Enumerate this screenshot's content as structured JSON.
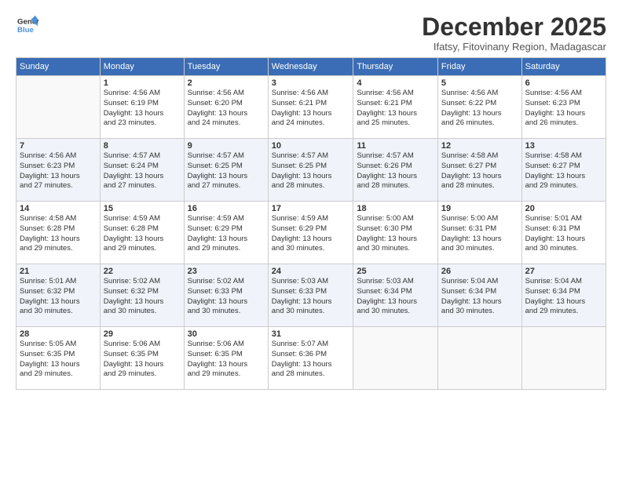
{
  "logo": {
    "general": "General",
    "blue": "Blue"
  },
  "title": "December 2025",
  "location": "Ifatsy, Fitovinany Region, Madagascar",
  "headers": [
    "Sunday",
    "Monday",
    "Tuesday",
    "Wednesday",
    "Thursday",
    "Friday",
    "Saturday"
  ],
  "weeks": [
    [
      {
        "day": "",
        "info": ""
      },
      {
        "day": "1",
        "info": "Sunrise: 4:56 AM\nSunset: 6:19 PM\nDaylight: 13 hours\nand 23 minutes."
      },
      {
        "day": "2",
        "info": "Sunrise: 4:56 AM\nSunset: 6:20 PM\nDaylight: 13 hours\nand 24 minutes."
      },
      {
        "day": "3",
        "info": "Sunrise: 4:56 AM\nSunset: 6:21 PM\nDaylight: 13 hours\nand 24 minutes."
      },
      {
        "day": "4",
        "info": "Sunrise: 4:56 AM\nSunset: 6:21 PM\nDaylight: 13 hours\nand 25 minutes."
      },
      {
        "day": "5",
        "info": "Sunrise: 4:56 AM\nSunset: 6:22 PM\nDaylight: 13 hours\nand 26 minutes."
      },
      {
        "day": "6",
        "info": "Sunrise: 4:56 AM\nSunset: 6:23 PM\nDaylight: 13 hours\nand 26 minutes."
      }
    ],
    [
      {
        "day": "7",
        "info": "Sunrise: 4:56 AM\nSunset: 6:23 PM\nDaylight: 13 hours\nand 27 minutes."
      },
      {
        "day": "8",
        "info": "Sunrise: 4:57 AM\nSunset: 6:24 PM\nDaylight: 13 hours\nand 27 minutes."
      },
      {
        "day": "9",
        "info": "Sunrise: 4:57 AM\nSunset: 6:25 PM\nDaylight: 13 hours\nand 27 minutes."
      },
      {
        "day": "10",
        "info": "Sunrise: 4:57 AM\nSunset: 6:25 PM\nDaylight: 13 hours\nand 28 minutes."
      },
      {
        "day": "11",
        "info": "Sunrise: 4:57 AM\nSunset: 6:26 PM\nDaylight: 13 hours\nand 28 minutes."
      },
      {
        "day": "12",
        "info": "Sunrise: 4:58 AM\nSunset: 6:27 PM\nDaylight: 13 hours\nand 28 minutes."
      },
      {
        "day": "13",
        "info": "Sunrise: 4:58 AM\nSunset: 6:27 PM\nDaylight: 13 hours\nand 29 minutes."
      }
    ],
    [
      {
        "day": "14",
        "info": "Sunrise: 4:58 AM\nSunset: 6:28 PM\nDaylight: 13 hours\nand 29 minutes."
      },
      {
        "day": "15",
        "info": "Sunrise: 4:59 AM\nSunset: 6:28 PM\nDaylight: 13 hours\nand 29 minutes."
      },
      {
        "day": "16",
        "info": "Sunrise: 4:59 AM\nSunset: 6:29 PM\nDaylight: 13 hours\nand 29 minutes."
      },
      {
        "day": "17",
        "info": "Sunrise: 4:59 AM\nSunset: 6:29 PM\nDaylight: 13 hours\nand 30 minutes."
      },
      {
        "day": "18",
        "info": "Sunrise: 5:00 AM\nSunset: 6:30 PM\nDaylight: 13 hours\nand 30 minutes."
      },
      {
        "day": "19",
        "info": "Sunrise: 5:00 AM\nSunset: 6:31 PM\nDaylight: 13 hours\nand 30 minutes."
      },
      {
        "day": "20",
        "info": "Sunrise: 5:01 AM\nSunset: 6:31 PM\nDaylight: 13 hours\nand 30 minutes."
      }
    ],
    [
      {
        "day": "21",
        "info": "Sunrise: 5:01 AM\nSunset: 6:32 PM\nDaylight: 13 hours\nand 30 minutes."
      },
      {
        "day": "22",
        "info": "Sunrise: 5:02 AM\nSunset: 6:32 PM\nDaylight: 13 hours\nand 30 minutes."
      },
      {
        "day": "23",
        "info": "Sunrise: 5:02 AM\nSunset: 6:33 PM\nDaylight: 13 hours\nand 30 minutes."
      },
      {
        "day": "24",
        "info": "Sunrise: 5:03 AM\nSunset: 6:33 PM\nDaylight: 13 hours\nand 30 minutes."
      },
      {
        "day": "25",
        "info": "Sunrise: 5:03 AM\nSunset: 6:34 PM\nDaylight: 13 hours\nand 30 minutes."
      },
      {
        "day": "26",
        "info": "Sunrise: 5:04 AM\nSunset: 6:34 PM\nDaylight: 13 hours\nand 30 minutes."
      },
      {
        "day": "27",
        "info": "Sunrise: 5:04 AM\nSunset: 6:34 PM\nDaylight: 13 hours\nand 29 minutes."
      }
    ],
    [
      {
        "day": "28",
        "info": "Sunrise: 5:05 AM\nSunset: 6:35 PM\nDaylight: 13 hours\nand 29 minutes."
      },
      {
        "day": "29",
        "info": "Sunrise: 5:06 AM\nSunset: 6:35 PM\nDaylight: 13 hours\nand 29 minutes."
      },
      {
        "day": "30",
        "info": "Sunrise: 5:06 AM\nSunset: 6:35 PM\nDaylight: 13 hours\nand 29 minutes."
      },
      {
        "day": "31",
        "info": "Sunrise: 5:07 AM\nSunset: 6:36 PM\nDaylight: 13 hours\nand 28 minutes."
      },
      {
        "day": "",
        "info": ""
      },
      {
        "day": "",
        "info": ""
      },
      {
        "day": "",
        "info": ""
      }
    ]
  ]
}
